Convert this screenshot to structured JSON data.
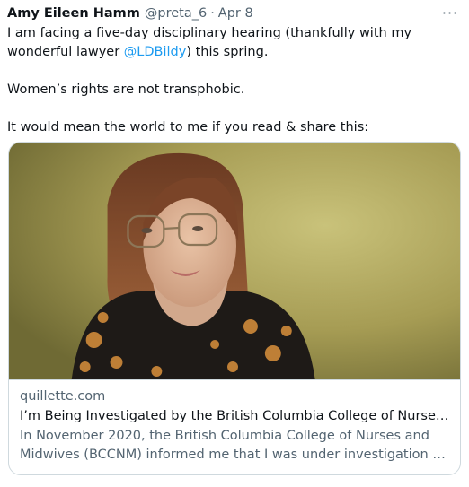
{
  "tweet": {
    "author_name": "Amy Eileen Hamm",
    "author_handle": "@preta_6",
    "separator": "·",
    "date": "Apr 8",
    "more_label": "···",
    "text_part1": "I am facing a five-day disciplinary hearing (thankfully with my wonderful lawyer ",
    "mention": "@LDBildy",
    "text_part2": ") this spring.\n\nWomen’s rights are not transphobic.\n\nIt would mean the world to me if you read & share this:"
  },
  "card": {
    "domain": "quillette.com",
    "title": "I’m Being Investigated by the British Columbia College of Nurses Beca...",
    "description_line1": "In November 2020, the British Columbia College of Nurses and",
    "description_line2": "Midwives (BCCNM) informed me that I was under investigation for my ..."
  },
  "colors": {
    "text": "#0f1419",
    "secondary": "#536471",
    "link": "#1d9bf0",
    "border": "#cfd9de"
  },
  "icons": {
    "more": "more-horizontal-icon",
    "image": "article-photo"
  }
}
